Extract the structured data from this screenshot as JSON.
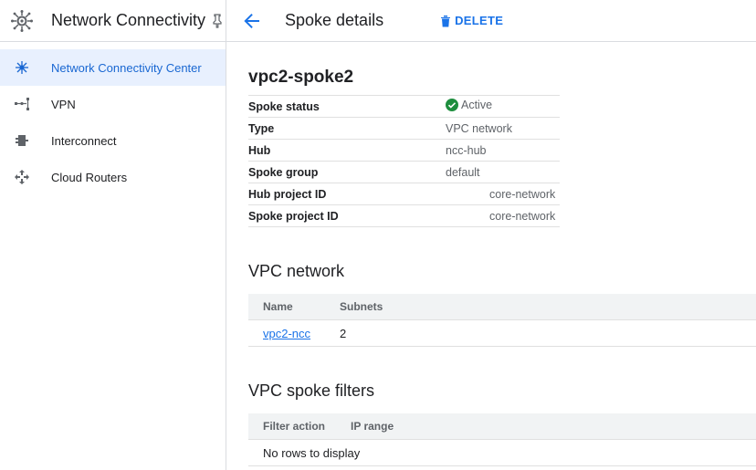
{
  "sidebar": {
    "title": "Network Connectivity",
    "items": [
      {
        "label": "Network Connectivity Center",
        "icon": "hub-icon"
      },
      {
        "label": "VPN",
        "icon": "vpn-icon"
      },
      {
        "label": "Interconnect",
        "icon": "interconnect-icon"
      },
      {
        "label": "Cloud Routers",
        "icon": "router-icon"
      }
    ]
  },
  "header": {
    "title": "Spoke details",
    "delete_label": "DELETE"
  },
  "spoke": {
    "name": "vpc2-spoke2",
    "details": [
      {
        "key": "Spoke status",
        "value": "Active"
      },
      {
        "key": "Type",
        "value": "VPC network"
      },
      {
        "key": "Hub",
        "value": "ncc-hub"
      },
      {
        "key": "Spoke group",
        "value": "default"
      },
      {
        "key": "Hub project ID",
        "value": "core-network"
      },
      {
        "key": "Spoke project ID",
        "value": "core-network"
      }
    ]
  },
  "vpc_network": {
    "title": "VPC network",
    "columns": [
      "Name",
      "Subnets"
    ],
    "rows": [
      {
        "name": "vpc2-ncc",
        "subnets": "2"
      }
    ]
  },
  "filters": {
    "title": "VPC spoke filters",
    "columns": [
      "Filter action",
      "IP range"
    ],
    "empty_text": "No rows to display"
  },
  "colors": {
    "accent": "#1a73e8",
    "active_bg": "#e8f0fe",
    "success": "#1e8e3e"
  }
}
